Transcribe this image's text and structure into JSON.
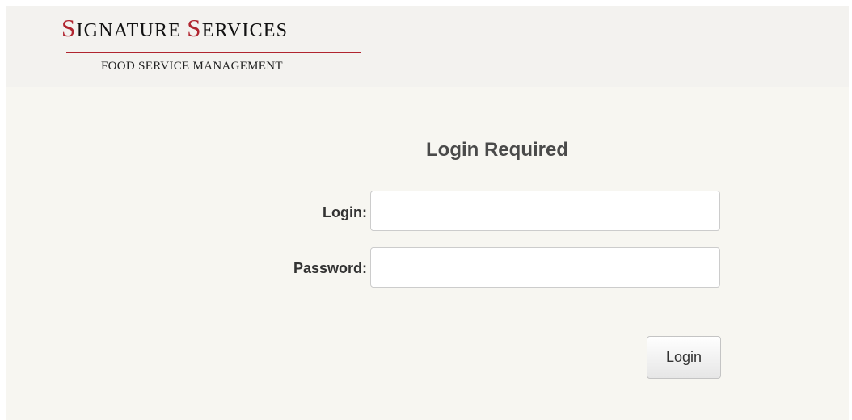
{
  "header": {
    "logo": {
      "title_first_initial": "S",
      "title_first_rest": "IGNATURE ",
      "title_second_initial": "S",
      "title_second_rest": "ERVICES",
      "subtitle": "FOOD SERVICE MANAGEMENT",
      "accent_color": "#b0252f"
    }
  },
  "login_form": {
    "title": "Login Required",
    "login_label": "Login:",
    "login_value": "",
    "password_label": "Password:",
    "password_value": "",
    "submit_label": "Login"
  },
  "colors": {
    "page_background": "#f7f6f1",
    "header_background": "#f3f2ef",
    "title_text": "#4a4a4a"
  }
}
